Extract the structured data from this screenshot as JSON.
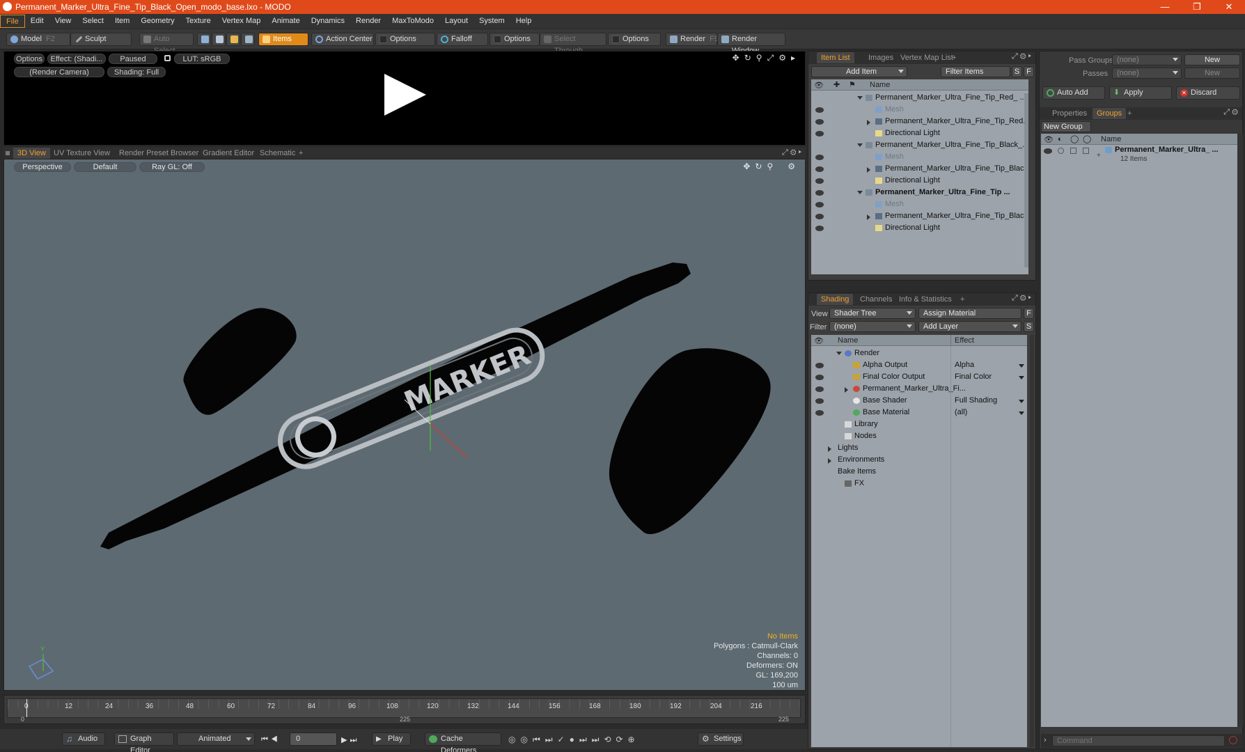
{
  "window": {
    "title": "Permanent_Marker_Ultra_Fine_Tip_Black_Open_modo_base.lxo - MODO",
    "controls": [
      "—",
      "❐",
      "✕"
    ]
  },
  "menu": [
    "File",
    "Edit",
    "View",
    "Select",
    "Item",
    "Geometry",
    "Texture",
    "Vertex Map",
    "Animate",
    "Dynamics",
    "Render",
    "MaxToModo",
    "Layout",
    "System",
    "Help"
  ],
  "toolbar": {
    "model": "Model",
    "model_shortcut": "F2",
    "sculpt": "Sculpt",
    "auto_select": "Auto Select",
    "items": "Items",
    "action_center": "Action Center",
    "options1": "Options",
    "falloff": "Falloff",
    "options2": "Options",
    "select_through": "Select Through",
    "options3": "Options",
    "render": "Render",
    "render_shortcut": "F9",
    "render_window": "Render Window"
  },
  "preview": {
    "options": "Options",
    "effect": "Effect: (Shadi...",
    "paused": "Paused",
    "lut": "LUT: sRGB",
    "camera": "(Render Camera)",
    "shading": "Shading: Full"
  },
  "view_tabs": [
    "3D View",
    "UV Texture View",
    "Render Preset Browser",
    "Gradient Editor",
    "Schematic",
    "+"
  ],
  "viewport": {
    "perspective": "Perspective",
    "default": "Default",
    "raygl": "Ray GL: Off",
    "logo_text": "MARKER",
    "stats": {
      "no_items": "No Items",
      "polygons": "Polygons : Catmull-Clark",
      "channels": "Channels: 0",
      "deformers": "Deformers: ON",
      "gl": "GL: 169,200",
      "unit": "100 um"
    },
    "axis_label": "Y"
  },
  "timeline": {
    "ticks": [
      "0",
      "12",
      "24",
      "36",
      "48",
      "60",
      "72",
      "84",
      "96",
      "108",
      "120",
      "132",
      "144",
      "156",
      "168",
      "180",
      "192",
      "204",
      "216"
    ],
    "start": "0",
    "mid": "225",
    "end": "225"
  },
  "bottom": {
    "audio": "Audio",
    "graph_editor": "Graph Editor",
    "animated": "Animated",
    "frame": "0",
    "play": "Play",
    "cache_deformers": "Cache Deformers",
    "settings": "Settings"
  },
  "item_panel": {
    "tabs": [
      "Item List",
      "Images",
      "Vertex Map List",
      "+"
    ],
    "add_item": "Add Item",
    "filter_items": "Filter Items",
    "s_btn": "S",
    "f_btn": "F",
    "col_name": "Name",
    "rows": [
      {
        "label": "Permanent_Marker_Ultra_Fine_Tip_Red_ ...",
        "indent": 0,
        "arrow": "down",
        "type": "scene",
        "eye": false,
        "dim": false,
        "bold": false
      },
      {
        "label": "Mesh",
        "indent": 1,
        "arrow": "",
        "type": "mesh",
        "eye": true,
        "dim": true,
        "bold": false
      },
      {
        "label": "Permanent_Marker_Ultra_Fine_Tip_Red...",
        "indent": 1,
        "arrow": "right",
        "type": "group",
        "eye": true,
        "dim": false,
        "bold": false
      },
      {
        "label": "Directional Light",
        "indent": 1,
        "arrow": "",
        "type": "light",
        "eye": true,
        "dim": false,
        "bold": false
      },
      {
        "label": "Permanent_Marker_Ultra_Fine_Tip_Black_...",
        "indent": 0,
        "arrow": "down",
        "type": "scene",
        "eye": false,
        "dim": false,
        "bold": false
      },
      {
        "label": "Mesh",
        "indent": 1,
        "arrow": "",
        "type": "mesh",
        "eye": true,
        "dim": true,
        "bold": false
      },
      {
        "label": "Permanent_Marker_Ultra_Fine_Tip_Blac...",
        "indent": 1,
        "arrow": "right",
        "type": "group",
        "eye": true,
        "dim": false,
        "bold": false
      },
      {
        "label": "Directional Light",
        "indent": 1,
        "arrow": "",
        "type": "light",
        "eye": true,
        "dim": false,
        "bold": false
      },
      {
        "label": "Permanent_Marker_Ultra_Fine_Tip ...",
        "indent": 0,
        "arrow": "down",
        "type": "scene",
        "eye": true,
        "dim": false,
        "bold": true
      },
      {
        "label": "Mesh",
        "indent": 1,
        "arrow": "",
        "type": "mesh",
        "eye": true,
        "dim": true,
        "bold": false
      },
      {
        "label": "Permanent_Marker_Ultra_Fine_Tip_Blac...",
        "indent": 1,
        "arrow": "right",
        "type": "group",
        "eye": true,
        "dim": false,
        "bold": false
      },
      {
        "label": "Directional Light",
        "indent": 1,
        "arrow": "",
        "type": "light",
        "eye": true,
        "dim": false,
        "bold": false
      }
    ]
  },
  "shading_panel": {
    "tabs": [
      "Shading",
      "Channels",
      "Info & Statistics",
      "+"
    ],
    "view_label": "View",
    "view_value": "Shader Tree",
    "assign_material": "Assign Material",
    "f_btn": "F",
    "filter_label": "Filter",
    "filter_value": "(none)",
    "add_layer": "Add Layer",
    "s_btn": "S",
    "col_name": "Name",
    "col_effect": "Effect",
    "rows": [
      {
        "label": "Render",
        "effect": "",
        "indent": 1,
        "arrow": "down",
        "icon": "render",
        "eye": false
      },
      {
        "label": "Alpha Output",
        "effect": "Alpha",
        "indent": 2,
        "arrow": "",
        "icon": "output",
        "eye": true
      },
      {
        "label": "Final Color Output",
        "effect": "Final Color",
        "indent": 2,
        "arrow": "",
        "icon": "output",
        "eye": true
      },
      {
        "label": "Permanent_Marker_Ultra_Fi...",
        "effect": "",
        "indent": 2,
        "arrow": "right",
        "icon": "material",
        "eye": true
      },
      {
        "label": "Base Shader",
        "effect": "Full Shading",
        "indent": 2,
        "arrow": "",
        "icon": "shader",
        "eye": true
      },
      {
        "label": "Base Material",
        "effect": "(all)",
        "indent": 2,
        "arrow": "",
        "icon": "basemat",
        "eye": true
      },
      {
        "label": "Library",
        "effect": "",
        "indent": 1,
        "arrow": "",
        "icon": "folder",
        "eye": false
      },
      {
        "label": "Nodes",
        "effect": "",
        "indent": 1,
        "arrow": "",
        "icon": "folder",
        "eye": false
      },
      {
        "label": "Lights",
        "effect": "",
        "indent": 0,
        "arrow": "right",
        "icon": "",
        "eye": false
      },
      {
        "label": "Environments",
        "effect": "",
        "indent": 0,
        "arrow": "right",
        "icon": "",
        "eye": false
      },
      {
        "label": "Bake Items",
        "effect": "",
        "indent": 0,
        "arrow": "",
        "icon": "",
        "eye": false
      },
      {
        "label": "FX",
        "effect": "",
        "indent": 1,
        "arrow": "",
        "icon": "fx",
        "eye": false
      }
    ]
  },
  "groups_panel": {
    "pass_groups_label": "Pass Groups",
    "pass_groups_value": "(none)",
    "passes_label": "Passes",
    "passes_value": "(none)",
    "new1": "New",
    "new2": "New",
    "auto_add": "Auto Add",
    "apply": "Apply",
    "discard": "Discard",
    "tabs": [
      "Properties",
      "Groups",
      "+"
    ],
    "new_group": "New Group",
    "col_name": "Name",
    "group_name": "Permanent_Marker_Ultra_ ...",
    "group_count": "12 Items",
    "command_placeholder": "Command"
  },
  "colors": {
    "accent": "#e08a1a",
    "titlebar": "#e04a1a",
    "viewport_bg": "#5e6a72",
    "tree_bg": "#9ca3aa"
  }
}
